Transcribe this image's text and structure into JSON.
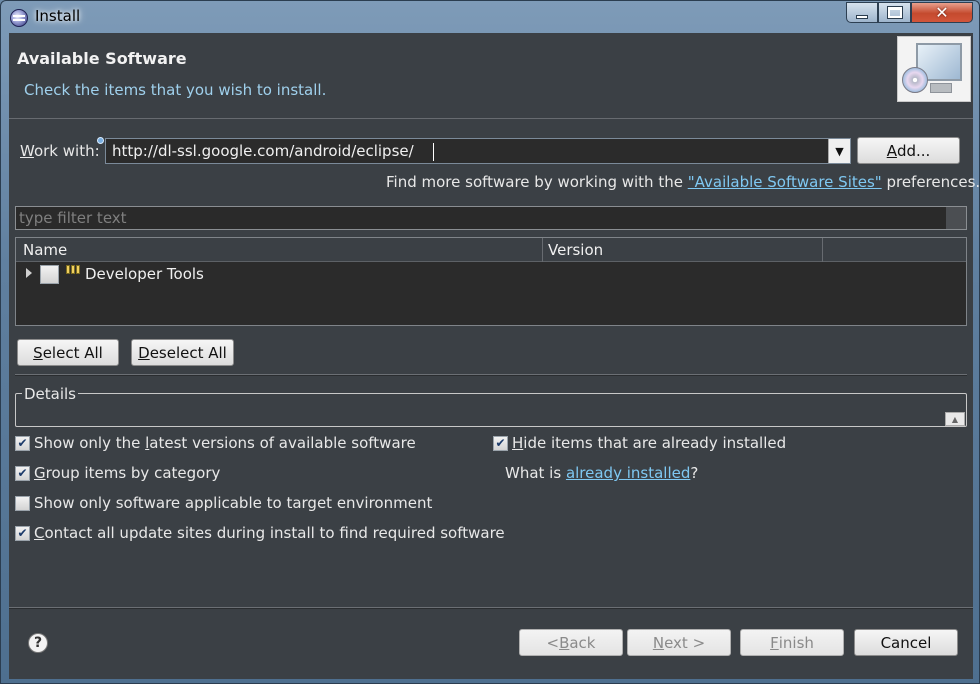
{
  "window": {
    "title": "Install",
    "minimize_glyph": "—",
    "close_glyph": "✕"
  },
  "header": {
    "title": "Available Software",
    "description": "Check the items that you wish to install.",
    "image_icon": "monitor-cd-icon"
  },
  "work_with": {
    "label_first": "W",
    "label_rest": "ork with:",
    "value": "http://dl-ssl.google.com/android/eclipse/",
    "add_button_first": "A",
    "add_button_rest": "dd..."
  },
  "sites_hint": {
    "prefix": "Find more software by working with the ",
    "link": "\"Available Software Sites\"",
    "suffix": " preferences."
  },
  "filter": {
    "placeholder": "type filter text"
  },
  "table": {
    "columns": [
      "Name",
      "Version"
    ],
    "rows": [
      {
        "name": "Developer Tools",
        "version": "",
        "checked": false
      }
    ]
  },
  "selection_buttons": {
    "select_all_first": "S",
    "select_all_rest": "elect All",
    "deselect_all_first": "D",
    "deselect_all_rest": "eselect All"
  },
  "details": {
    "label": "Details"
  },
  "options": {
    "latest_versions": {
      "before": "Show only the ",
      "key": "l",
      "after": "atest versions of available software",
      "checked": true
    },
    "group_by_category": {
      "key": "G",
      "after": "roup items by category",
      "checked": true
    },
    "target_env": {
      "before": "Show only software applicable to target environment",
      "checked": false
    },
    "contact_sites": {
      "key": "C",
      "after": "ontact all update sites during install to find required software",
      "checked": true
    },
    "hide_installed": {
      "key": "H",
      "after": "ide items that are already installed",
      "checked": true
    }
  },
  "already_installed": {
    "prefix": "What is ",
    "link": "already installed",
    "suffix": "?"
  },
  "footer": {
    "back_prefix": "< ",
    "back_key": "B",
    "back_rest": "ack",
    "next_key": "N",
    "next_rest": "ext >",
    "finish_key": "F",
    "finish_rest": "inish",
    "cancel": "Cancel"
  },
  "colors": {
    "panel": "#3b4045",
    "link": "#7fc8f2",
    "title_bar": "#6b8aa8"
  }
}
